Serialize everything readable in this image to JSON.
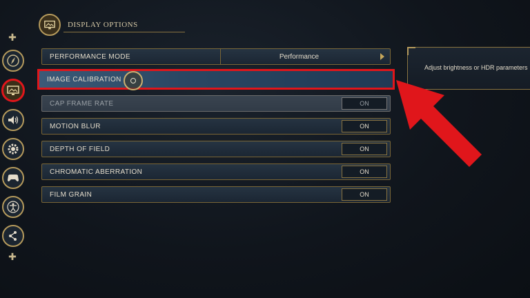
{
  "header": {
    "title": "DISPLAY OPTIONS",
    "icon": "monitor-icon"
  },
  "sidebar": {
    "top_nav_icon": "dpad-icon",
    "bottom_nav_icon": "dpad-icon",
    "items": [
      {
        "icon": "compass-icon",
        "active": false
      },
      {
        "icon": "monitor-icon",
        "active": true
      },
      {
        "icon": "speaker-icon",
        "active": false
      },
      {
        "icon": "gear-icon",
        "active": false
      },
      {
        "icon": "gamepad-icon",
        "active": false
      },
      {
        "icon": "accessibility-icon",
        "active": false
      },
      {
        "icon": "share-icon",
        "active": false
      }
    ]
  },
  "settings": {
    "performance_mode": {
      "label": "PERFORMANCE MODE",
      "value": "Performance"
    },
    "image_calibration": {
      "label": "IMAGE CALIBRATION"
    },
    "cap_frame_rate": {
      "label": "CAP FRAME RATE",
      "value": "ON",
      "disabled": true
    },
    "motion_blur": {
      "label": "MOTION BLUR",
      "value": "ON"
    },
    "depth_of_field": {
      "label": "DEPTH OF FIELD",
      "value": "ON"
    },
    "chromatic_aberration": {
      "label": "CHROMATIC ABERRATION",
      "value": "ON"
    },
    "film_grain": {
      "label": "FILM GRAIN",
      "value": "ON"
    }
  },
  "description": {
    "text": "Adjust brightness or HDR parameters"
  },
  "colors": {
    "highlight": "#e0161b",
    "gold": "#b59a5c",
    "selected_row": "#2a4763"
  }
}
